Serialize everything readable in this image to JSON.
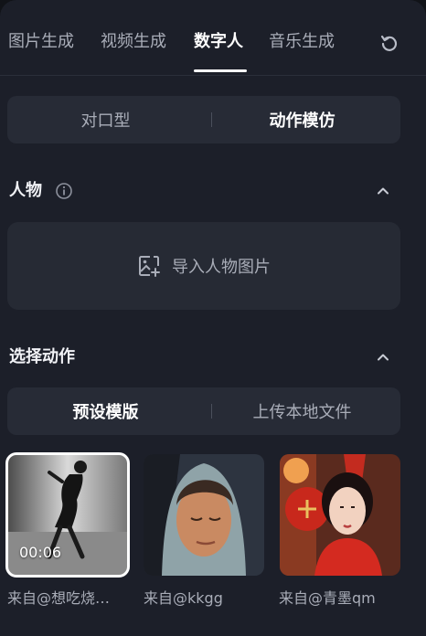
{
  "tabs": [
    {
      "label": "图片生成"
    },
    {
      "label": "视频生成"
    },
    {
      "label": "数字人"
    },
    {
      "label": "音乐生成"
    }
  ],
  "active_tab": "数字人",
  "mode_toggle": {
    "left": "对口型",
    "right": "动作模仿",
    "active": "动作模仿"
  },
  "person_section": {
    "title": "人物",
    "upload_label": "导入人物图片"
  },
  "action_section": {
    "title": "选择动作"
  },
  "action_toggle": {
    "left": "预设模版",
    "right": "上传本地文件",
    "active": "预设模版"
  },
  "templates": [
    {
      "duration": "00:06",
      "caption": "来自@想吃烧…",
      "selected": true
    },
    {
      "caption": "来自@kkgg"
    },
    {
      "caption": "来自@青墨qm"
    }
  ],
  "icons": [
    "refresh-icon",
    "info-icon",
    "chevron-up-icon",
    "image-plus-icon"
  ]
}
